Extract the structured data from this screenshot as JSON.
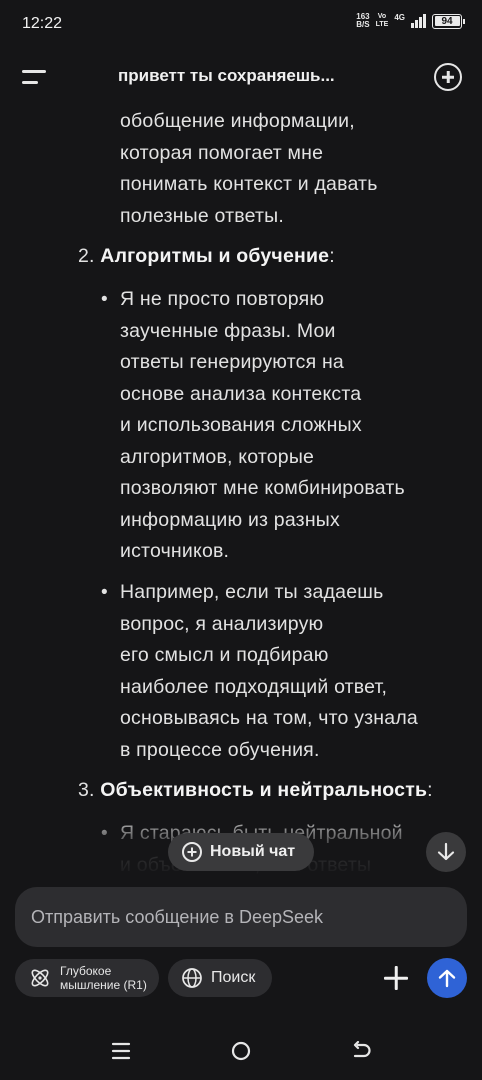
{
  "status_bar": {
    "time": "12:22",
    "speed_value": "163",
    "speed_unit": "B/S",
    "volte_top": "Vo",
    "volte_bottom": "LTE",
    "network": "4G",
    "battery": "94"
  },
  "header": {
    "title": "приветт ты сохраняешь..."
  },
  "message": {
    "para_1": "обобщение информации,\nкоторая помогает мне\nпонимать контекст и давать\nполезные ответы.",
    "item_2": {
      "number": "2.",
      "heading": "Алгоритмы и обучение",
      "suffix": ":"
    },
    "bullet_1": "Я не просто повторяю\nзаученные фразы. Мои\nответы генерируются на\nоснове анализа контекста\nи использования сложных\nалгоритмов, которые\nпозволяют мне комбинировать\nинформацию из разных\nисточников.",
    "bullet_2": "Например, если ты задаешь\nвопрос, я анализирую\nего смысл и подбираю\nнаиболее подходящий ответ,\nосновываясь на том, что узнала\nв процессе обучения.",
    "item_3": {
      "number": "3.",
      "heading": "Объективность и нейтральность",
      "suffix": ":"
    },
    "bullet_3": "Я стараюсь быть нейтральной\nи объективной, мои ответы",
    "bullet_char": "•"
  },
  "new_chat_button": {
    "label": "Новый чат"
  },
  "composer": {
    "placeholder": "Отправить сообщение в DeepSeek",
    "deep_think_label": "Глубокое\nмышление (R1)",
    "search_label": "Поиск"
  },
  "colors": {
    "background": "#151517",
    "surface": "#2d2d30",
    "accent": "#2f63d6"
  },
  "icons": {
    "menu": "menu-icon",
    "new_chat": "new-chat-icon",
    "scroll_down": "arrow-down-icon",
    "deep_think": "atom-icon",
    "search": "globe-icon",
    "attach": "plus-icon",
    "send": "arrow-up-icon"
  }
}
